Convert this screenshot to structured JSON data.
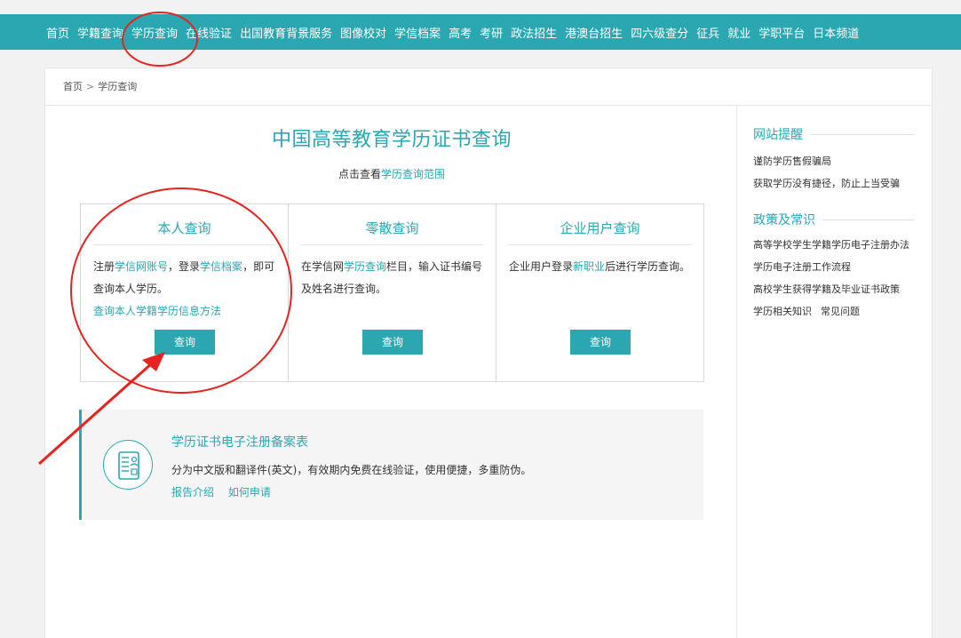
{
  "nav": {
    "items": [
      "首页",
      "学籍查询",
      "学历查询",
      "在线验证",
      "出国教育背景服务",
      "图像校对",
      "学信档案",
      "高考",
      "考研",
      "政法招生",
      "港澳台招生",
      "四六级查分",
      "征兵",
      "就业",
      "学职平台",
      "日本频道"
    ]
  },
  "breadcrumb": {
    "home": "首页",
    "sep": ">",
    "current": "学历查询"
  },
  "main": {
    "title": "中国高等教育学历证书查询",
    "subtitle_prefix": "点击查看",
    "subtitle_link": "学历查询范围"
  },
  "boxes": {
    "self": {
      "title": "本人查询",
      "t1": "注册",
      "l1": "学信网账号",
      "t2": "，登录",
      "l2": "学信档案",
      "t3": "，即可查询本人学历。",
      "link": "查询本人学籍学历信息方法",
      "button": "查询"
    },
    "single": {
      "title": "零散查询",
      "t1": "在学信网",
      "l1": "学历查询",
      "t2": "栏目，输入证书编号及姓名进行查询。",
      "button": "查询"
    },
    "enterprise": {
      "title": "企业用户查询",
      "t1": "企业用户登录",
      "l1": "新职业",
      "t2": "后进行学历查询。",
      "button": "查询"
    }
  },
  "registration": {
    "title": "学历证书电子注册备案表",
    "desc": "分为中文版和翻译件(英文)，有效期内免费在线验证，使用便捷，多重防伪。",
    "link1": "报告介绍",
    "link2": "如何申请"
  },
  "sidebar": {
    "notice": {
      "heading": "网站提醒",
      "items": [
        "谨防学历售假骗局",
        "获取学历没有捷径，防止上当受骗"
      ]
    },
    "policy": {
      "heading": "政策及常识",
      "items": [
        "高等学校学生学籍学历电子注册办法",
        "学历电子注册工作流程",
        "高校学生获得学籍及毕业证书政策"
      ],
      "last_a": "学历相关知识",
      "last_b": "常见问题"
    }
  },
  "colors": {
    "accent": "#2aa7b1",
    "annotation": "#e8231f"
  }
}
